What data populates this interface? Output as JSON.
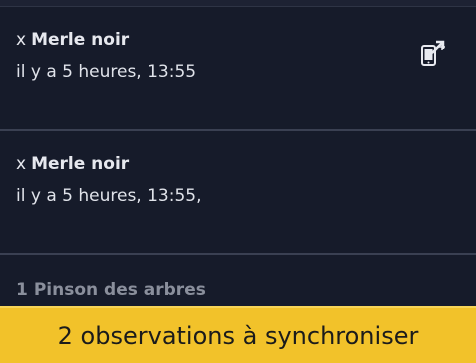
{
  "observations": [
    {
      "prefix": "x",
      "species": "Merle noir",
      "time": "il y a 5 heures, 13:55",
      "icon": "phone-sync-icon"
    },
    {
      "prefix": "x",
      "species": "Merle noir",
      "time": "il y a 5 heures, 13:55,"
    },
    {
      "prefix": "1",
      "species": "Pinson des arbres"
    }
  ],
  "sync_bar": {
    "label": "2 observations à synchroniser",
    "color": "#f2c22a"
  }
}
